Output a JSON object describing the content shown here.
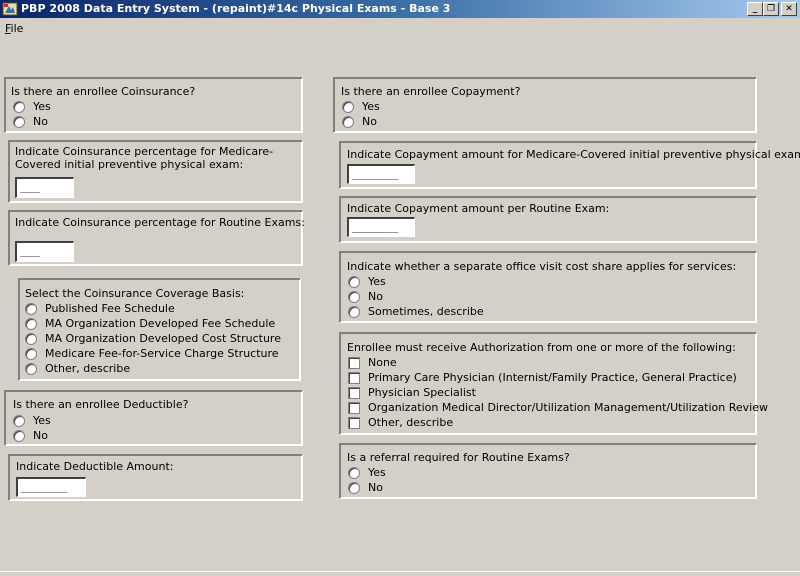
{
  "window": {
    "title": "PBP 2008 Data Entry System - (repaint)#14c Physical Exams - Base 3",
    "minimize_glyph": "_",
    "restore_glyph": "❐",
    "close_glyph": "✕"
  },
  "menu": {
    "file_accel": "F",
    "file_rest": "ile"
  },
  "left": {
    "coinsurance": {
      "question": "Is there an enrollee Coinsurance?",
      "yes": "Yes",
      "no": "No"
    },
    "coins_medicare": {
      "label": "Indicate Coinsurance percentage for Medicare-Covered initial preventive physical exam:",
      "value": "___"
    },
    "coins_routine": {
      "label": "Indicate Coinsurance percentage for Routine Exams:",
      "value": "___"
    },
    "basis": {
      "label": "Select the Coinsurance Coverage Basis:",
      "options": [
        "Published Fee Schedule",
        "MA Organization Developed Fee Schedule",
        "MA Organization Developed Cost Structure",
        "Medicare Fee-for-Service Charge Structure",
        "Other, describe"
      ]
    },
    "deductible": {
      "question": "Is there an enrollee Deductible?",
      "yes": "Yes",
      "no": "No"
    },
    "deductible_amount": {
      "label": "Indicate Deductible Amount:",
      "value": "_______"
    }
  },
  "right": {
    "copayment": {
      "question": "Is there an enrollee Copayment?",
      "yes": "Yes",
      "no": "No"
    },
    "copay_medicare": {
      "label": "Indicate Copayment amount for Medicare-Covered initial preventive physical exam:",
      "value": "_______"
    },
    "copay_routine": {
      "label": "Indicate Copayment amount per Routine Exam:",
      "value": "_______"
    },
    "office_visit": {
      "question": "Indicate whether a separate office visit cost share applies for services:",
      "yes": "Yes",
      "no": "No",
      "sometimes": "Sometimes, describe"
    },
    "authorization": {
      "label": "Enrollee must receive Authorization from one or more of the following:",
      "options": [
        "None",
        "Primary Care Physician (Internist/Family Practice, General Practice)",
        "Physician Specialist",
        "Organization Medical Director/Utilization Management/Utilization Review",
        "Other, describe"
      ]
    },
    "referral": {
      "question": "Is a referral required for Routine Exams?",
      "yes": "Yes",
      "no": "No"
    }
  }
}
